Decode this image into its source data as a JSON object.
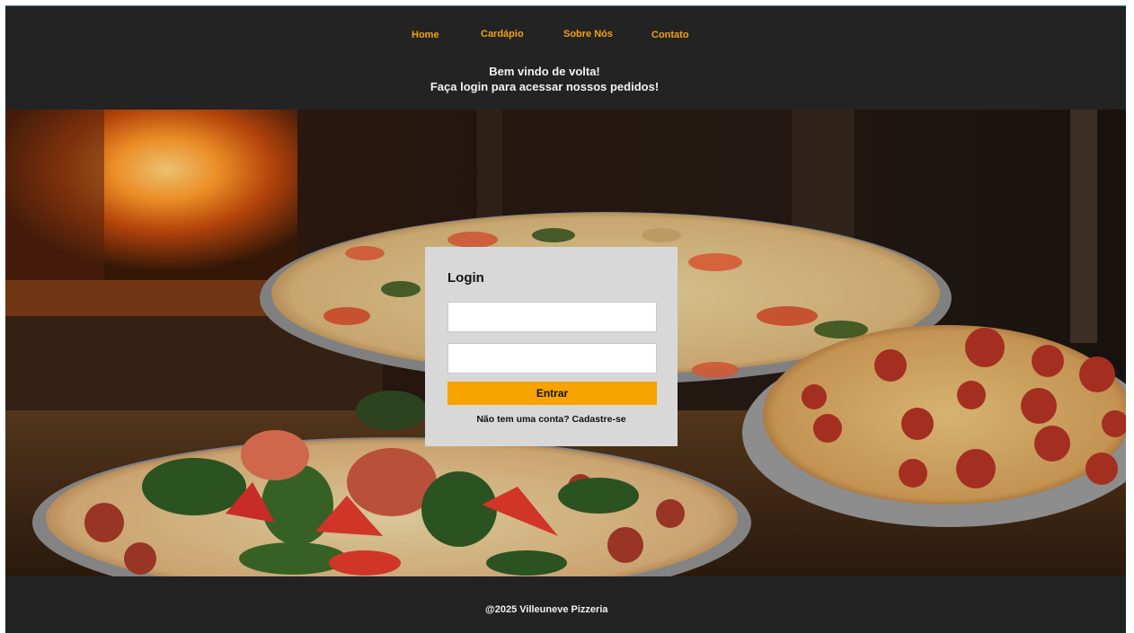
{
  "nav": {
    "items": [
      {
        "label": "Home"
      },
      {
        "label": "Cardápio"
      },
      {
        "label": "Sobre Nós"
      },
      {
        "label": "Contato"
      }
    ],
    "link_color": "#f0a21a"
  },
  "header": {
    "welcome_line1": "Bem vindo de volta!",
    "welcome_line2": "Faça login para acessar nossos pedidos!"
  },
  "login": {
    "title": "Login",
    "username_value": "",
    "password_value": "",
    "submit_label": "Entrar",
    "signup_text": "Não tem uma conta? Cadastre-se",
    "button_color": "#f7a400"
  },
  "footer": {
    "copyright": "@2025 Villeuneve Pizzeria"
  },
  "colors": {
    "background": "#232323",
    "card": "#d8d8d8",
    "accent": "#f7a400"
  }
}
